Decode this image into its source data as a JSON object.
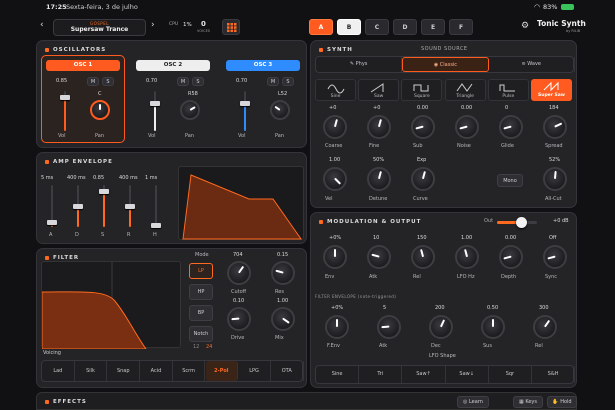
{
  "status": {
    "time": "17:25",
    "date": "Sexta-feira, 3 de julho",
    "battery": "83%"
  },
  "topbar": {
    "preset_category": "GOSPEL",
    "preset_name": "Supersaw Trance",
    "cpu_label": "CPU",
    "cpu_value": "1%",
    "voices_value": "0",
    "voices_label": "VOICES",
    "slots": [
      "A",
      "B",
      "C",
      "D",
      "E",
      "F"
    ],
    "active_slot": "A",
    "selected_slot": "B",
    "app_title": "Tonic Synth",
    "app_sub": "by RiLiB"
  },
  "oscillators": {
    "title": "OSCILLATORS",
    "osc": [
      {
        "name": "OSC 1",
        "vol": "0.85",
        "pan": "C",
        "color": "#ff5a1f"
      },
      {
        "name": "OSC 2",
        "vol": "0.70",
        "pan": "R58",
        "color": "#eeeeee"
      },
      {
        "name": "OSC 3",
        "vol": "0.70",
        "pan": "L52",
        "color": "#2f8cff"
      }
    ],
    "m": "M",
    "s": "S",
    "vol_label": "Vol",
    "pan_label": "Pan"
  },
  "amp": {
    "title": "AMP ENVELOPE",
    "values": [
      "5 ms",
      "400 ms",
      "0.85",
      "400 ms",
      "1 ms"
    ],
    "labels": [
      "A",
      "D",
      "S",
      "R",
      "H"
    ],
    "levels": [
      0.12,
      0.5,
      0.85,
      0.5,
      0.05
    ]
  },
  "filter": {
    "title": "FILTER",
    "mode_label": "Mode",
    "modes": [
      "LP",
      "HP",
      "BP",
      "Notch"
    ],
    "active_mode": "LP",
    "slope_labels": [
      "12",
      "24"
    ],
    "knobs": [
      {
        "label": "Cutoff",
        "value": "704"
      },
      {
        "label": "Res",
        "value": "0.15"
      },
      {
        "label": "Drive",
        "value": "0.10"
      },
      {
        "label": "Mix",
        "value": "1.00"
      }
    ],
    "voicing_label": "Voicing",
    "voicing": [
      "Lad",
      "Silk",
      "Snap",
      "Acid",
      "Scrm",
      "2-Pol",
      "LPG",
      "OTA"
    ],
    "active_voicing": "2-Pol"
  },
  "synth": {
    "title": "SYNTH",
    "source_label": "SOUND SOURCE",
    "sources": [
      "Phys",
      "Classic",
      "Wave"
    ],
    "active_source": "Classic",
    "waves": [
      "Sine",
      "Saw",
      "Square",
      "Triangle",
      "Pulse",
      "Super Saw"
    ],
    "active_wave": "Super Saw",
    "knobs_row1": [
      {
        "label": "Coarse",
        "value": "+0"
      },
      {
        "label": "Fine",
        "value": "+0"
      },
      {
        "label": "Sub",
        "value": "0.00"
      },
      {
        "label": "Noise",
        "value": "0.00"
      },
      {
        "label": "Glide",
        "value": "0"
      },
      {
        "label": "Spread",
        "value": "184"
      }
    ],
    "knobs_row2": [
      {
        "label": "Vel",
        "value": "1.00"
      },
      {
        "label": "Detune",
        "value": "50%"
      },
      {
        "label": "Curve",
        "value": "Exp"
      },
      {
        "label": "Mono",
        "value": ""
      },
      {
        "label": "All-Cut",
        "value": "52%"
      }
    ]
  },
  "modulation": {
    "title": "MODULATION & OUTPUT",
    "out_label": "Out",
    "out_value": "+0 dB",
    "out_level": 0.6,
    "knobs": [
      {
        "label": "Env",
        "value": "+0%"
      },
      {
        "label": "Atk",
        "value": "10"
      },
      {
        "label": "Rel",
        "value": "150"
      },
      {
        "label": "LFO Hz",
        "value": "1.00"
      },
      {
        "label": "Depth",
        "value": "0.00"
      },
      {
        "label": "Sync",
        "value": "Off"
      }
    ],
    "filter_env_label": "FILTER ENVELOPE (note-triggered)",
    "fenv": [
      {
        "label": "F.Env",
        "value": "+0%"
      },
      {
        "label": "Atk",
        "value": "5"
      },
      {
        "label": "Dec",
        "value": "200"
      },
      {
        "label": "Sus",
        "value": "0.50"
      },
      {
        "label": "Rel",
        "value": "300"
      }
    ],
    "lfo_shape_label": "LFO Shape",
    "lfo_shapes": [
      "Sine",
      "Tri",
      "Saw↑",
      "Saw↓",
      "Sqr",
      "S&H"
    ]
  },
  "footer": {
    "effects": "EFFECTS",
    "learn": "Learn",
    "keys": "Keys",
    "hold": "Hold"
  }
}
